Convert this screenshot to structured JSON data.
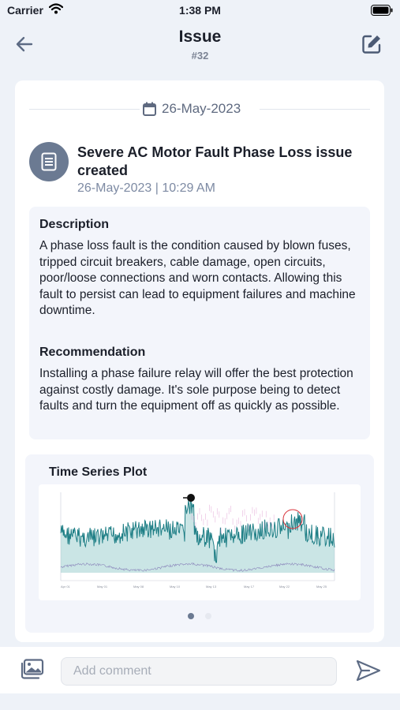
{
  "status_bar": {
    "carrier": "Carrier",
    "time": "1:38 PM"
  },
  "nav": {
    "title": "Issue",
    "subtitle": "#32"
  },
  "date_separator": "26-May-2023",
  "issue": {
    "title": "Severe AC Motor Fault Phase Loss issue created",
    "timestamp": "26-May-2023 | 10:29 AM"
  },
  "description": {
    "heading": "Description",
    "body": "A phase loss fault is the condition caused by blown fuses, tripped circuit breakers, cable damage, open circuits, poor/loose connections and worn contacts. Allowing this fault to persist can lead to equipment failures and machine downtime."
  },
  "recommendation": {
    "heading": "Recommendation",
    "body": "Installing a phase failure relay will offer the best protection against costly damage. It's sole purpose being to detect faults and turn the equipment off as quickly as possible."
  },
  "plot": {
    "title": "Time Series Plot",
    "page_count": 2,
    "active_page": 1
  },
  "comment": {
    "placeholder": "Add comment"
  },
  "colors": {
    "accent": "#6b7a92",
    "teal": "#1f7f86",
    "date": "#5f6a80"
  },
  "icons": [
    "back-arrow-icon",
    "edit-icon",
    "calendar-icon",
    "document-icon",
    "gallery-icon",
    "send-icon",
    "wifi-icon",
    "battery-icon"
  ]
}
